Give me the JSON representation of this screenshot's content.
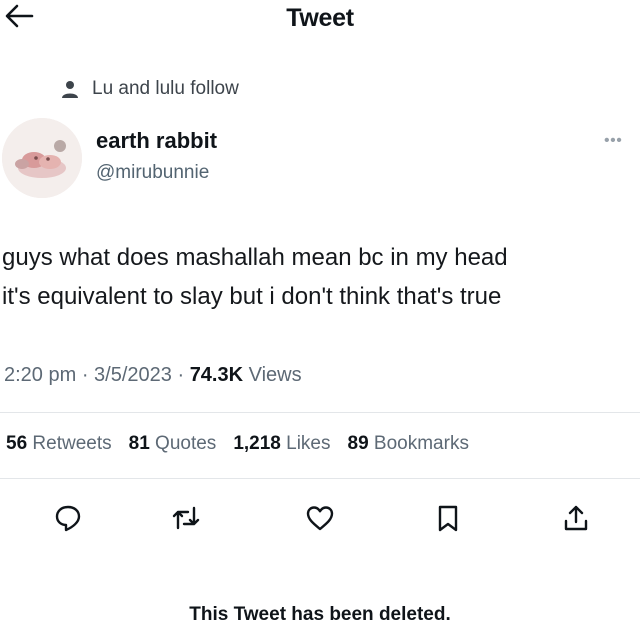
{
  "header": {
    "title": "Tweet"
  },
  "social_context": {
    "text": "Lu and lulu follow"
  },
  "author": {
    "name": "earth rabbit",
    "handle": "@mirubunnie"
  },
  "tweet": {
    "line1": "guys what does mashallah mean bc in my head",
    "line2": "it's equivalent to slay but i don't think that's true"
  },
  "meta": {
    "time": "2:20 pm",
    "date": "3/5/2023",
    "views_count": "74.3K",
    "views_label": "Views"
  },
  "stats": [
    {
      "count": "56",
      "label": "Retweets"
    },
    {
      "count": "81",
      "label": "Quotes"
    },
    {
      "count": "1,218",
      "label": "Likes"
    },
    {
      "count": "89",
      "label": "Bookmarks"
    }
  ],
  "footer": {
    "notice": "This Tweet has been deleted."
  }
}
